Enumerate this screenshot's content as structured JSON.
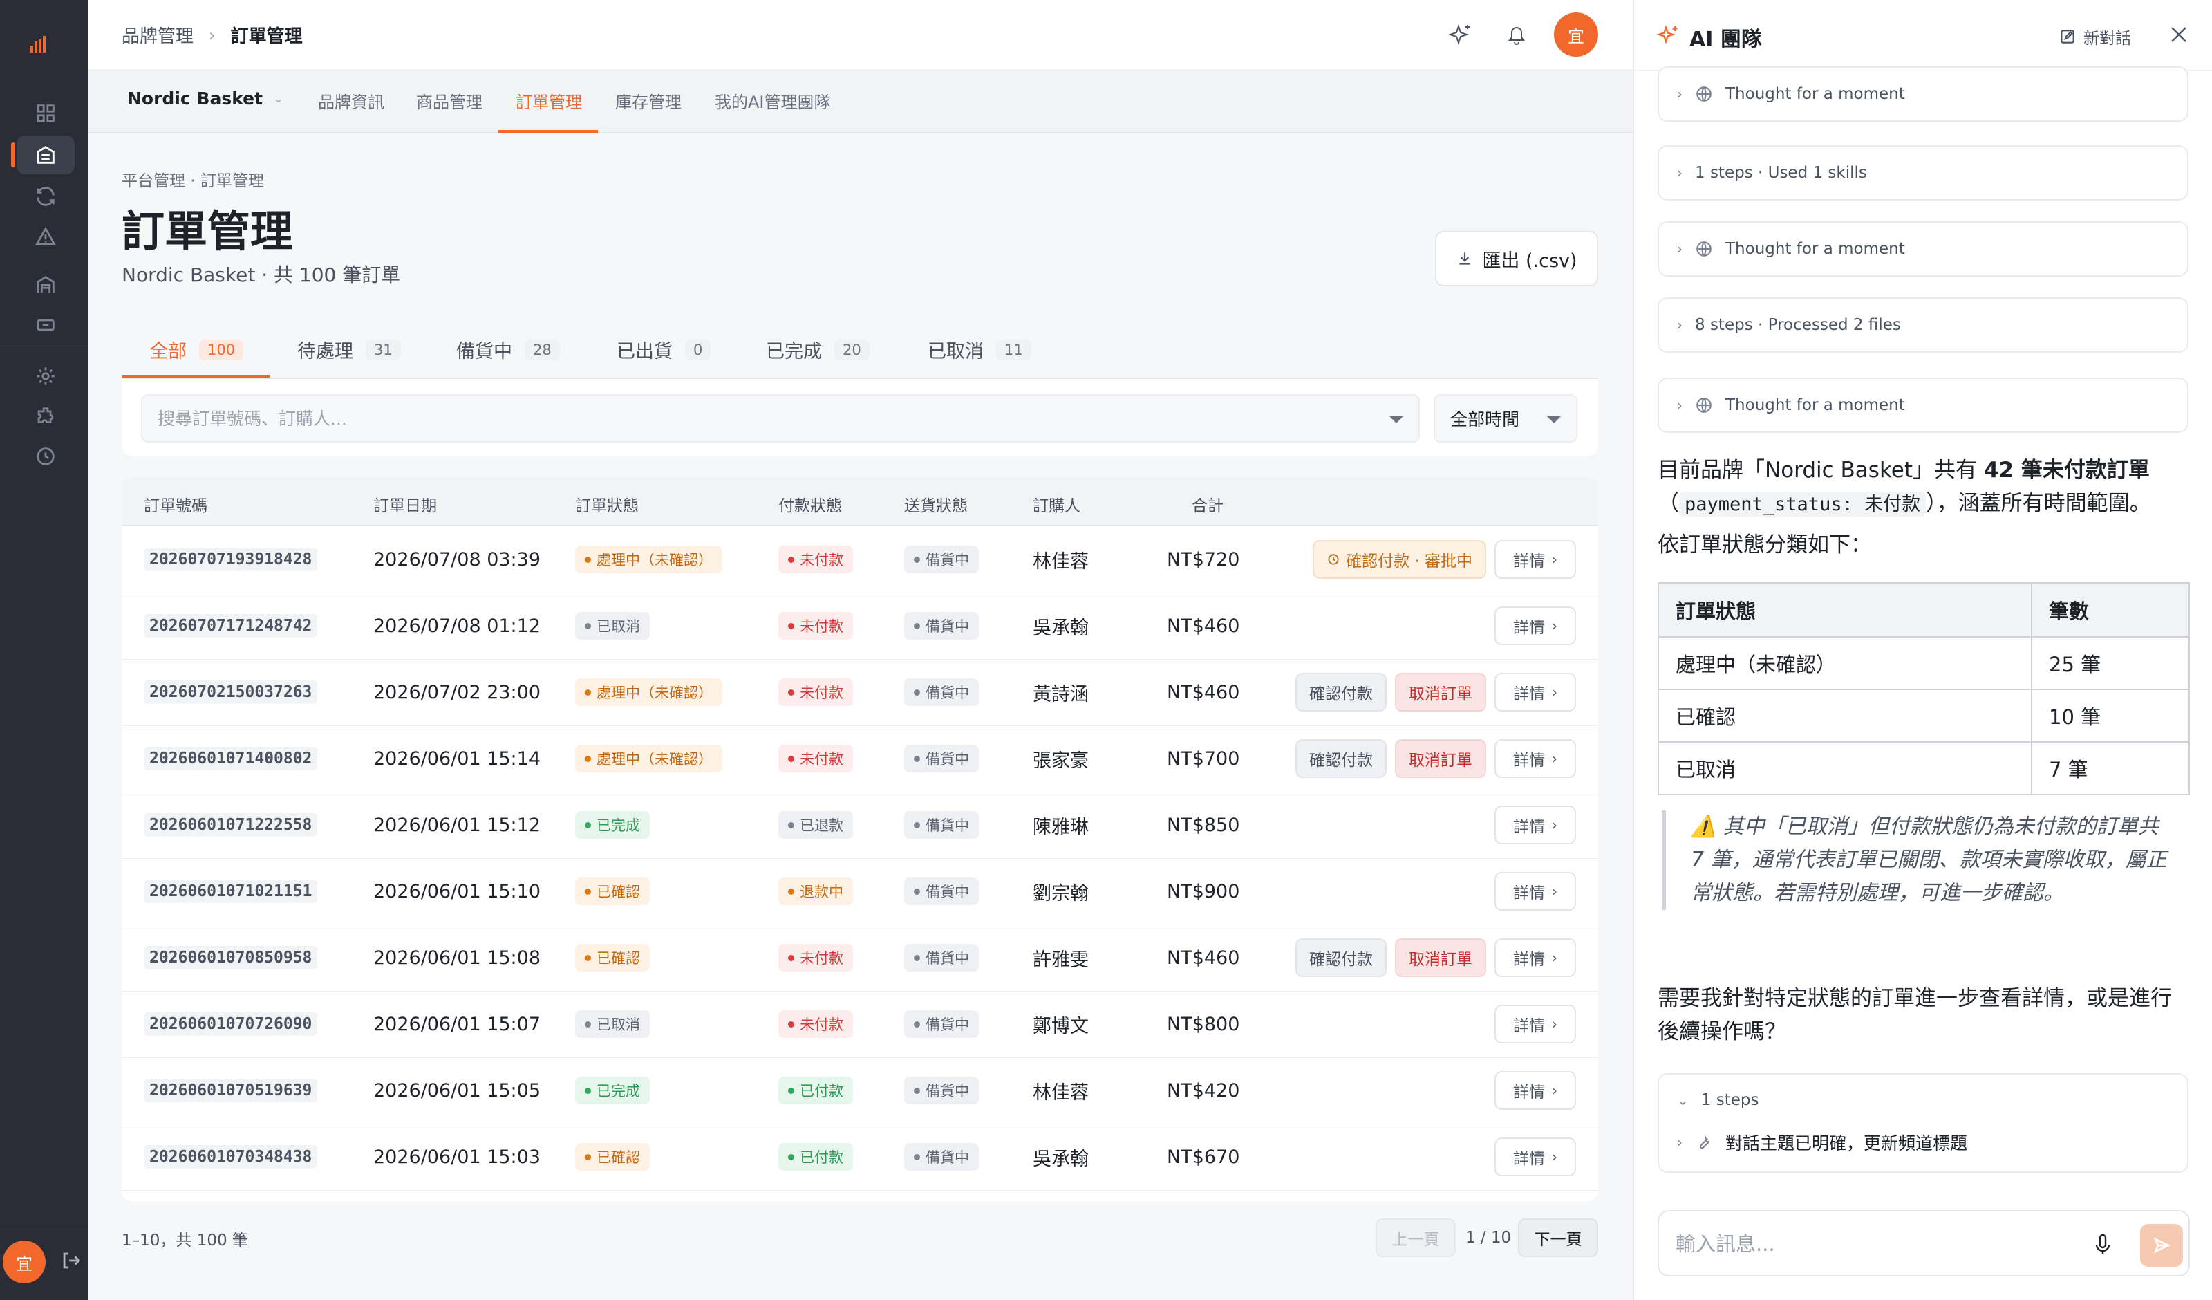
{
  "sidebar": {
    "avatar": "宜"
  },
  "topbar": {
    "crumbs": [
      "品牌管理",
      "訂單管理"
    ],
    "avatar": "宜"
  },
  "subnav": {
    "brand": "Nordic Basket",
    "tabs": [
      "品牌資訊",
      "商品管理",
      "訂單管理",
      "庫存管理",
      "我的AI管理團隊"
    ]
  },
  "page": {
    "crumb": "平台管理 · 訂單管理",
    "title": "訂單管理",
    "subtitle": "Nordic Basket · 共 100 筆訂單",
    "export_label": "匯出 (.csv)"
  },
  "status_tabs": [
    {
      "label": "全部",
      "count": "100"
    },
    {
      "label": "待處理",
      "count": "31"
    },
    {
      "label": "備貨中",
      "count": "28"
    },
    {
      "label": "已出貨",
      "count": "0"
    },
    {
      "label": "已完成",
      "count": "20"
    },
    {
      "label": "已取消",
      "count": "11"
    }
  ],
  "filters": {
    "search_placeholder": "搜尋訂單號碼、訂購人...",
    "time": "全部時間"
  },
  "table": {
    "headers": [
      "訂單號碼",
      "訂單日期",
      "訂單狀態",
      "付款狀態",
      "送貨狀態",
      "訂購人",
      "合計"
    ],
    "rows": [
      {
        "id": "20260707193918428",
        "date": "2026/07/08 03:39",
        "status": "處理中（未確認）",
        "status_color": "orange",
        "payment": "未付款",
        "payment_color": "red",
        "shipping": "備貨中",
        "buyer": "林佳蓉",
        "total": "NT$720",
        "actions": [
          {
            "label": "確認付款 · 審批中",
            "style": "warn"
          }
        ]
      },
      {
        "id": "20260707171248742",
        "date": "2026/07/08 01:12",
        "status": "已取消",
        "status_color": "gray",
        "payment": "未付款",
        "payment_color": "red",
        "shipping": "備貨中",
        "buyer": "吳承翰",
        "total": "NT$460",
        "actions": []
      },
      {
        "id": "20260702150037263",
        "date": "2026/07/02 23:00",
        "status": "處理中（未確認）",
        "status_color": "orange",
        "payment": "未付款",
        "payment_color": "red",
        "shipping": "備貨中",
        "buyer": "黃詩涵",
        "total": "NT$460",
        "actions": [
          {
            "label": "確認付款",
            "style": "gray"
          },
          {
            "label": "取消訂單",
            "style": "red"
          }
        ]
      },
      {
        "id": "20260601071400802",
        "date": "2026/06/01 15:14",
        "status": "處理中（未確認）",
        "status_color": "orange",
        "payment": "未付款",
        "payment_color": "red",
        "shipping": "備貨中",
        "buyer": "張家豪",
        "total": "NT$700",
        "actions": [
          {
            "label": "確認付款",
            "style": "gray"
          },
          {
            "label": "取消訂單",
            "style": "red"
          }
        ]
      },
      {
        "id": "20260601071222558",
        "date": "2026/06/01 15:12",
        "status": "已完成",
        "status_color": "green",
        "payment": "已退款",
        "payment_color": "gray",
        "shipping": "備貨中",
        "buyer": "陳雅琳",
        "total": "NT$850",
        "actions": []
      },
      {
        "id": "20260601071021151",
        "date": "2026/06/01 15:10",
        "status": "已確認",
        "status_color": "orange",
        "payment": "退款中",
        "payment_color": "orange",
        "shipping": "備貨中",
        "buyer": "劉宗翰",
        "total": "NT$900",
        "actions": []
      },
      {
        "id": "20260601070850958",
        "date": "2026/06/01 15:08",
        "status": "已確認",
        "status_color": "orange",
        "payment": "未付款",
        "payment_color": "red",
        "shipping": "備貨中",
        "buyer": "許雅雯",
        "total": "NT$460",
        "actions": [
          {
            "label": "確認付款",
            "style": "gray"
          },
          {
            "label": "取消訂單",
            "style": "red"
          }
        ]
      },
      {
        "id": "20260601070726090",
        "date": "2026/06/01 15:07",
        "status": "已取消",
        "status_color": "gray",
        "payment": "未付款",
        "payment_color": "red",
        "shipping": "備貨中",
        "buyer": "鄭博文",
        "total": "NT$800",
        "actions": []
      },
      {
        "id": "20260601070519639",
        "date": "2026/06/01 15:05",
        "status": "已完成",
        "status_color": "green",
        "payment": "已付款",
        "payment_color": "green",
        "shipping": "備貨中",
        "buyer": "林佳蓉",
        "total": "NT$420",
        "actions": []
      },
      {
        "id": "20260601070348438",
        "date": "2026/06/01 15:03",
        "status": "已確認",
        "status_color": "orange",
        "payment": "已付款",
        "payment_color": "green",
        "shipping": "備貨中",
        "buyer": "吳承翰",
        "total": "NT$670",
        "actions": []
      }
    ],
    "detail_label": "詳情"
  },
  "pagination": {
    "info": "1–10，共 100 筆",
    "prev": "上一頁",
    "page": "1 / 10",
    "next": "下一頁"
  },
  "ai_panel": {
    "title": "AI 團隊",
    "new_chat": "新對話",
    "steps": [
      {
        "label": "Thought for a moment",
        "icon": "globe-icon"
      },
      {
        "label": "1 steps · Used 1 skills",
        "icon": ""
      },
      {
        "label": "Thought for a moment",
        "icon": "globe-icon"
      },
      {
        "label": "8 steps · Processed 2 files",
        "icon": ""
      },
      {
        "label": "Thought for a moment",
        "icon": "globe-icon"
      }
    ],
    "msg1_pre": "目前品牌「Nordic Basket」共有 ",
    "msg1_bold": "42 筆未付款訂單",
    "msg1_code": "payment_status: 未付款",
    "msg1_post": "，涵蓋所有時間範圍。",
    "msg2": "依訂單狀態分類如下：",
    "table_headers": [
      "訂單狀態",
      "筆數"
    ],
    "table_rows": [
      [
        "處理中（未確認）",
        "25 筆"
      ],
      [
        "已確認",
        "10 筆"
      ],
      [
        "已取消",
        "7 筆"
      ]
    ],
    "quote": "其中「已取消」但付款狀態仍為未付款的訂單共 7 筆，通常代表訂單已關閉、款項未實際收取，屬正常狀態。若需特別處理，可進一步確認。",
    "quote_icon": "⚠️",
    "msg3": "需要我針對特定狀態的訂單進一步查看詳情，或是進行後續操作嗎？",
    "tool_steps": "1 steps",
    "tool_label": "對話主題已明確，更新頻道標題",
    "composer_placeholder": "輸入訊息..."
  },
  "colors": {
    "accent": "#f2682c",
    "sidebar": "#2a2d35"
  }
}
